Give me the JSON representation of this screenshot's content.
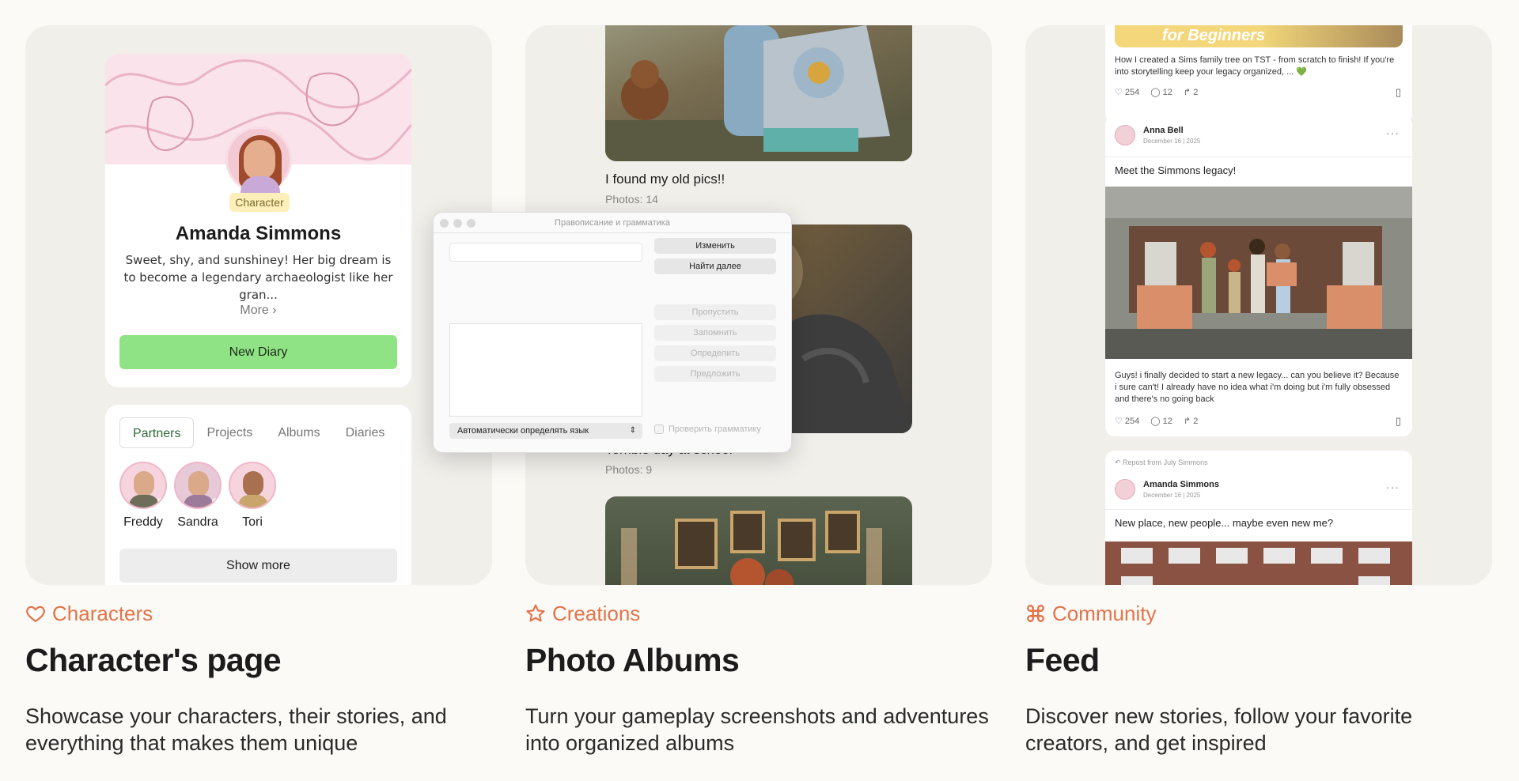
{
  "panels": {
    "characters": {
      "category": "Characters",
      "title": "Character's page",
      "description": "Showcase your characters, their stories, and everything that makes them unique",
      "card": {
        "badge": "Character",
        "name": "Amanda Simmons",
        "bio": "Sweet, shy, and sunshiney! Her big dream is to become a legendary archaeologist like her gran...",
        "more_label": "More",
        "new_diary_label": "New Diary"
      },
      "relations": {
        "tabs": [
          "Partners",
          "Projects",
          "Albums",
          "Diaries"
        ],
        "active_tab": "Partners",
        "friends": [
          {
            "name": "Freddy",
            "online": true
          },
          {
            "name": "Sandra",
            "online": true
          },
          {
            "name": "Tori",
            "online": false
          }
        ],
        "show_more_label": "Show more"
      }
    },
    "creations": {
      "category": "Creations",
      "title": "Photo Albums",
      "description": "Turn your gameplay screenshots and adventures into organized albums",
      "albums": [
        {
          "title": "I found my old pics!!",
          "photos": "Photos: 14"
        },
        {
          "title": "Terrible day at school",
          "photos": "Photos: 9"
        }
      ],
      "dialog": {
        "title": "Правописание и грамматика",
        "change_label": "Изменить",
        "find_next_label": "Найти далее",
        "skip_label": "Пропустить",
        "learn_label": "Запомнить",
        "define_label": "Определить",
        "guess_label": "Предложить",
        "language_select": "Автоматически определять язык",
        "check_grammar_label": "Проверить грамматику"
      }
    },
    "community": {
      "category": "Community",
      "title": "Feed",
      "description": "Discover new stories, follow your favorite creators, and get inspired",
      "posts": [
        {
          "banner_text": "for Beginners",
          "text": "How I created a Sims family tree on TST - from scratch to finish! If you're into storytelling keep your legacy organized, ... 💚",
          "likes": "254",
          "comments": "12",
          "reposts": "2"
        },
        {
          "author": "Anna Bell",
          "date": "December 16 | 2025",
          "caption": "Meet the Simmons legacy!",
          "text": "Guys! i finally decided to start a new legacy... can you believe it? Because i sure can't! I already have no idea what i'm doing but i'm fully obsessed and there's no going back",
          "likes": "254",
          "comments": "12",
          "reposts": "2"
        },
        {
          "repost_from": "Repost from July Simmons",
          "author": "Amanda Simmons",
          "date": "December 16 | 2025",
          "caption": "New place, new people... maybe even new me?"
        }
      ]
    }
  },
  "colors": {
    "accent": "#e2744a",
    "green_button": "#90e384",
    "panel_bg": "#f0efea"
  },
  "icons": [
    "heart-icon",
    "star-icon",
    "command-icon"
  ]
}
